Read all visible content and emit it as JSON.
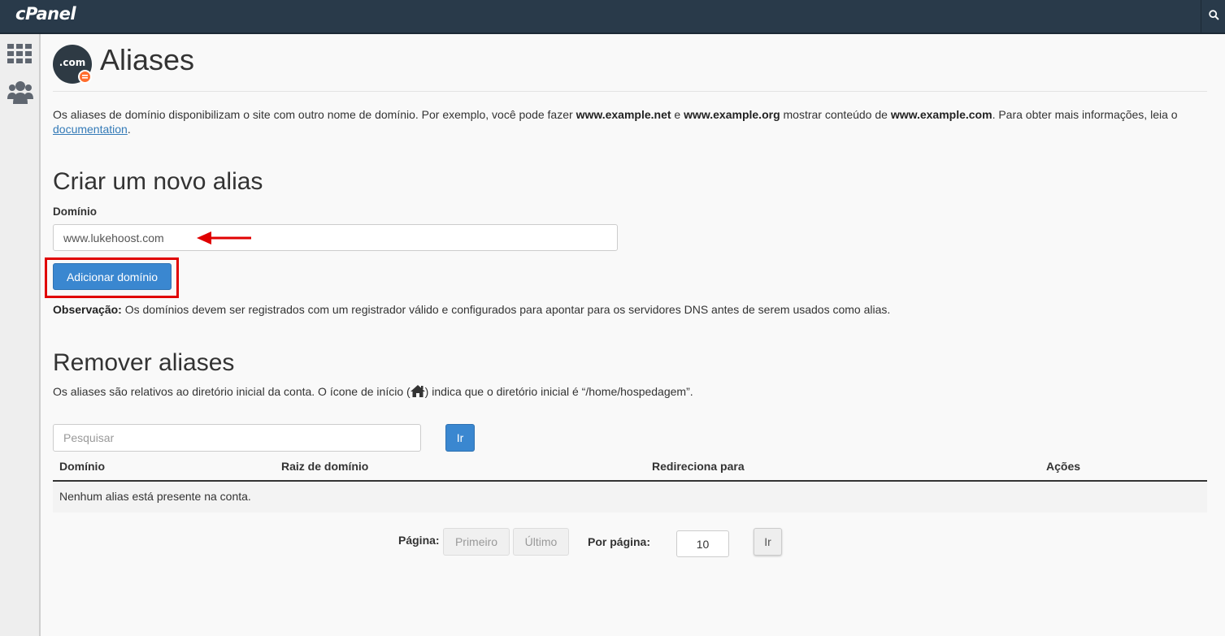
{
  "app": {
    "logo_text": "cPanel"
  },
  "header": {
    "icon_text": ".com",
    "title": "Aliases"
  },
  "intro": {
    "part1": "Os aliases de domínio disponibilizam o site com outro nome de domínio. Por exemplo, você pode fazer ",
    "ex1": "www.example.net",
    "part2": " e ",
    "ex2": "www.example.org",
    "part3": " mostrar conteúdo de ",
    "ex3": "www.example.com",
    "part4": ". Para obter mais informações, leia o ",
    "link": "documentation",
    "part5": "."
  },
  "create": {
    "heading": "Criar um novo alias",
    "field_label": "Domínio",
    "field_value": "www.lukehoost.com",
    "button": "Adicionar domínio",
    "note_label": "Observação:",
    "note_text": " Os domínios devem ser registrados com um registrador válido e configurados para apontar para os servidores DNS antes de serem usados como alias."
  },
  "remove": {
    "heading": "Remover aliases",
    "desc_part1": "Os aliases são relativos ao diretório inicial da conta. O ícone de início (",
    "desc_part2": ") indica que o diretório inicial é “/home/hospedagem”.",
    "search_placeholder": "Pesquisar",
    "go": "Ir"
  },
  "table": {
    "headers": [
      "Domínio",
      "Raiz de domínio",
      "Redireciona para",
      "Ações"
    ],
    "empty": "Nenhum alias está presente na conta."
  },
  "pager": {
    "page_label": "Página:",
    "first": "Primeiro",
    "last": "Último",
    "per_page_label": "Por página:",
    "per_page_value": "10",
    "go": "Ir"
  },
  "colors": {
    "topbar": "#293a4a",
    "primary": "#3a87d0",
    "highlight": "#e00000",
    "badge": "#ff6c2c"
  },
  "icons": [
    "search-icon",
    "apps-grid-icon",
    "users-icon",
    "domain-icon",
    "home-icon",
    "arrow-icon"
  ]
}
